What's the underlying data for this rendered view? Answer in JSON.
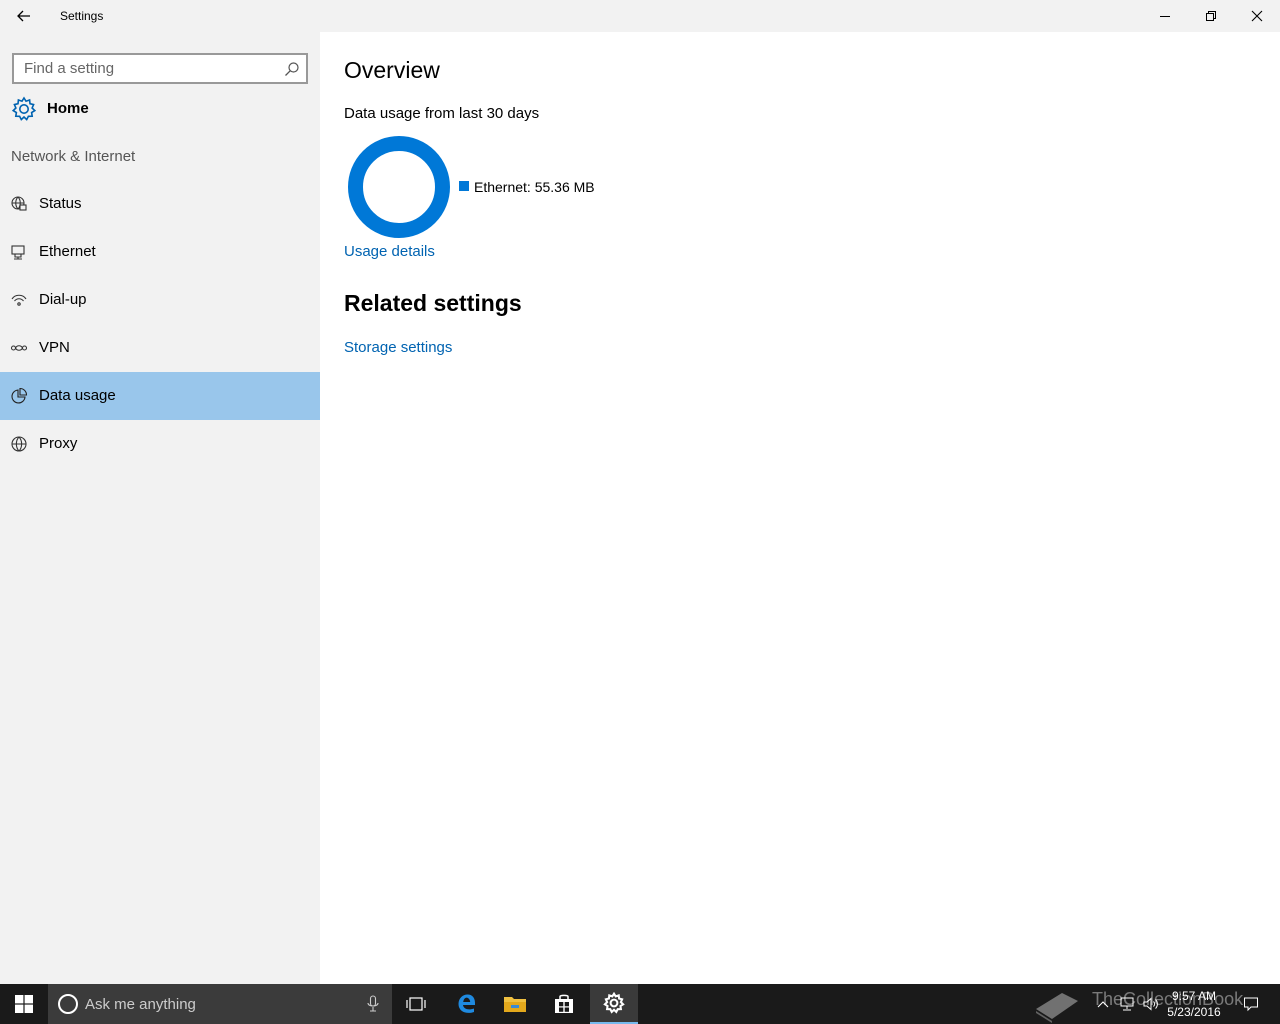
{
  "window": {
    "title": "Settings"
  },
  "sidebar": {
    "search_placeholder": "Find a setting",
    "home_label": "Home",
    "section_title": "Network & Internet",
    "items": [
      {
        "label": "Status",
        "icon": "status-icon"
      },
      {
        "label": "Ethernet",
        "icon": "ethernet-icon"
      },
      {
        "label": "Dial-up",
        "icon": "dialup-icon"
      },
      {
        "label": "VPN",
        "icon": "vpn-icon"
      },
      {
        "label": "Data usage",
        "icon": "data-usage-icon",
        "selected": true
      },
      {
        "label": "Proxy",
        "icon": "globe-icon"
      }
    ]
  },
  "main": {
    "overview_title": "Overview",
    "usage_subtitle": "Data usage from last 30 days",
    "chart": {
      "type": "pie",
      "series": [
        {
          "name": "Ethernet",
          "value": 55.36,
          "unit": "MB",
          "color": "#0078d7"
        }
      ],
      "legend_text": "Ethernet: 55.36 MB"
    },
    "usage_details_link": "Usage details",
    "related_title": "Related settings",
    "storage_link": "Storage settings"
  },
  "taskbar": {
    "search_placeholder": "Ask me anything",
    "time": "9:57 AM",
    "date": "5/23/2016",
    "watermark": "TheCollectionBook"
  },
  "colors": {
    "accent": "#0078d7",
    "link": "#0063b1",
    "selected": "#99c6eb",
    "sidebar_bg": "#f2f2f2",
    "taskbar_bg": "#1a1a1a"
  }
}
